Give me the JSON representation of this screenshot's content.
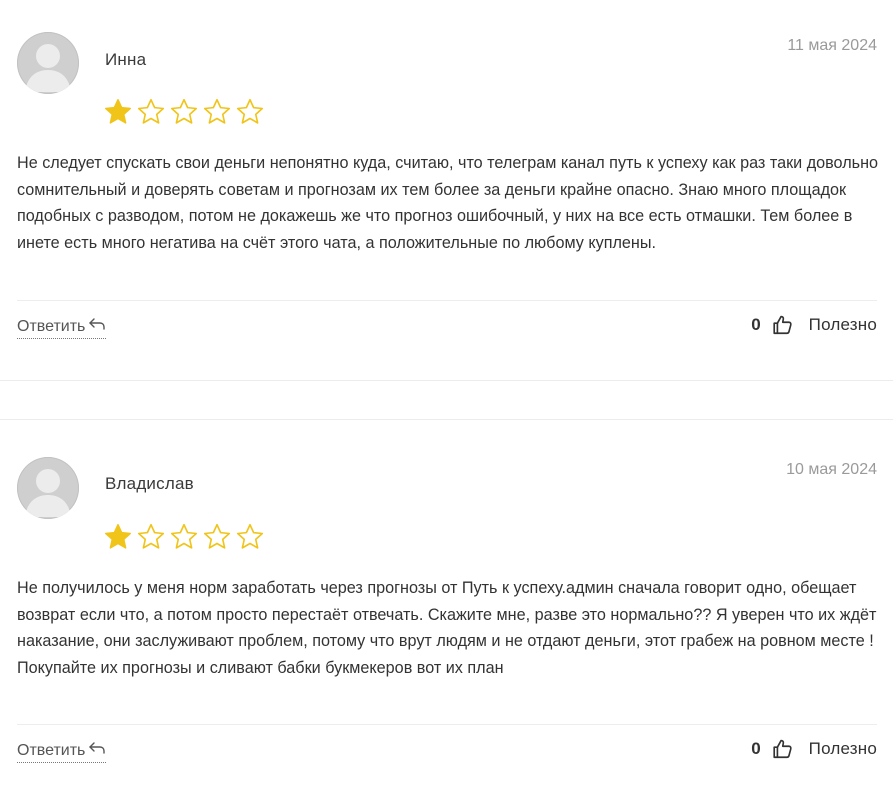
{
  "reviews": [
    {
      "author": "Инна",
      "date": "11 мая 2024",
      "rating": 1,
      "max_rating": 5,
      "text": "Не следует спускать свои деньги непонятно куда, считаю, что телеграм канал путь к успеху как раз таки довольно сомнительный и доверять советам и прогнозам их тем более за деньги крайне опасно. Знаю много площадок подобных с разводом, потом не докажешь же что прогноз ошибочный, у них на все есть отмашки. Тем более в инете есть много негатива на счёт этого чата, а положительные по любому куплены.",
      "reply_label": "Ответить",
      "helpful_count": "0",
      "helpful_label": "Полезно"
    },
    {
      "author": "Владислав",
      "date": "10 мая 2024",
      "rating": 1,
      "max_rating": 5,
      "text": "Не получилось у меня норм заработать через прогнозы от Путь к успеху.админ сначала говорит одно, обещает возврат если что, а потом просто перестаёт отвечать. Скажите мне, разве это нормально?? Я уверен что их ждёт наказание, они заслуживают проблем, потому что врут людям и не отдают деньги, этот грабеж на ровном месте ! Покупайте их прогнозы и сливают бабки букмекеров вот их план",
      "reply_label": "Ответить",
      "helpful_count": "0",
      "helpful_label": "Полезно"
    }
  ],
  "colors": {
    "star_filled": "#f0c419",
    "star_empty_outline": "#f0c419",
    "text": "#333333",
    "date": "#9a9a9a",
    "divider": "#ededed",
    "avatar_bg": "#cfcfcf"
  },
  "icons": {
    "avatar": "user-placeholder-icon",
    "star": "star-icon",
    "reply": "reply-arrow-icon",
    "helpful": "thumbs-up-icon"
  }
}
